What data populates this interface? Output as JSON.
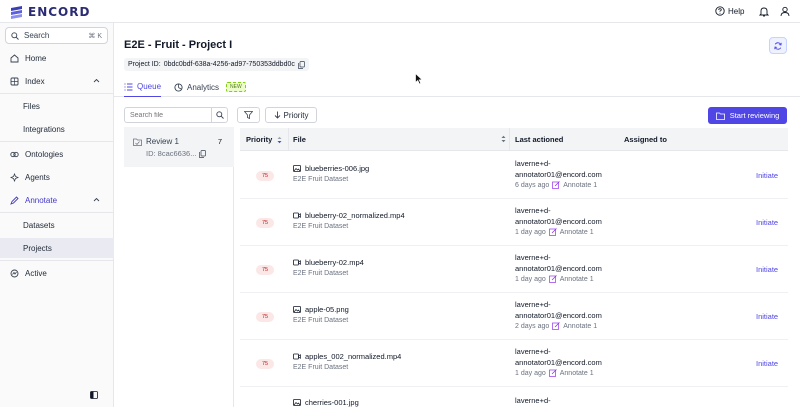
{
  "app": {
    "logo_text": "ENCORD",
    "accent": "#4f46e5"
  },
  "topbar": {
    "help_label": "Help",
    "icons": [
      "help-icon",
      "bell-icon",
      "user-icon"
    ]
  },
  "sidebar": {
    "search_label": "Search",
    "search_shortcut": "⌘ K",
    "items": [
      {
        "label": "Home",
        "icon": "home-icon"
      },
      {
        "label": "Index",
        "icon": "index-icon",
        "expanded": true
      },
      {
        "label": "Files"
      },
      {
        "label": "Integrations"
      },
      {
        "label": "Ontologies",
        "icon": "ontologies-icon"
      },
      {
        "label": "Agents",
        "icon": "agents-icon"
      },
      {
        "label": "Annotate",
        "icon": "annotate-icon",
        "expanded": true,
        "active": true
      },
      {
        "label": "Datasets"
      },
      {
        "label": "Projects",
        "selected": true
      },
      {
        "label": "Active",
        "icon": "active-icon"
      }
    ]
  },
  "project": {
    "title": "E2E - Fruit - Project I",
    "id_label": "Project ID:",
    "id_value": "0bdc0bdf-638a-4256-ad97-750353ddbd0c"
  },
  "tabs": [
    {
      "label": "Queue",
      "active": true,
      "icon": "list-icon"
    },
    {
      "label": "Analytics",
      "icon": "analytics-icon",
      "badge": "NEW"
    }
  ],
  "toolbar": {
    "search_placeholder": "Search file",
    "priority_label": "Priority",
    "start_label": "Start reviewing"
  },
  "stages": [
    {
      "name": "Review 1",
      "count": "7",
      "id": "ID: 8cac6636..."
    }
  ],
  "table": {
    "headers": {
      "priority": "Priority",
      "file": "File",
      "last_actioned": "Last actioned",
      "assigned_to": "Assigned to"
    },
    "rows": [
      {
        "priority": "75",
        "file": "blueberries-006.jpg",
        "type": "image",
        "dataset": "E2E Fruit Dataset",
        "user": "laverne+d-annotator01@encord.com",
        "time": "6 days ago",
        "stage": "Annotate 1",
        "action": "Initiate"
      },
      {
        "priority": "75",
        "file": "blueberry-02_normalized.mp4",
        "type": "video",
        "dataset": "E2E Fruit Dataset",
        "user": "laverne+d-annotator01@encord.com",
        "time": "1 day ago",
        "stage": "Annotate 1",
        "action": "Initiate"
      },
      {
        "priority": "75",
        "file": "blueberry-02.mp4",
        "type": "video",
        "dataset": "E2E Fruit Dataset",
        "user": "laverne+d-annotator01@encord.com",
        "time": "1 day ago",
        "stage": "Annotate 1",
        "action": "Initiate"
      },
      {
        "priority": "75",
        "file": "apple-05.png",
        "type": "image",
        "dataset": "E2E Fruit Dataset",
        "user": "laverne+d-annotator01@encord.com",
        "time": "2 days ago",
        "stage": "Annotate 1",
        "action": "Initiate"
      },
      {
        "priority": "75",
        "file": "apples_002_normalized.mp4",
        "type": "video",
        "dataset": "E2E Fruit Dataset",
        "user": "laverne+d-annotator01@encord.com",
        "time": "1 day ago",
        "stage": "Annotate 1",
        "action": "Initiate"
      },
      {
        "priority": "",
        "file": "cherries-001.jpg",
        "type": "image",
        "dataset": "",
        "user": "laverne+d-",
        "time": "",
        "stage": "",
        "action": ""
      }
    ]
  }
}
